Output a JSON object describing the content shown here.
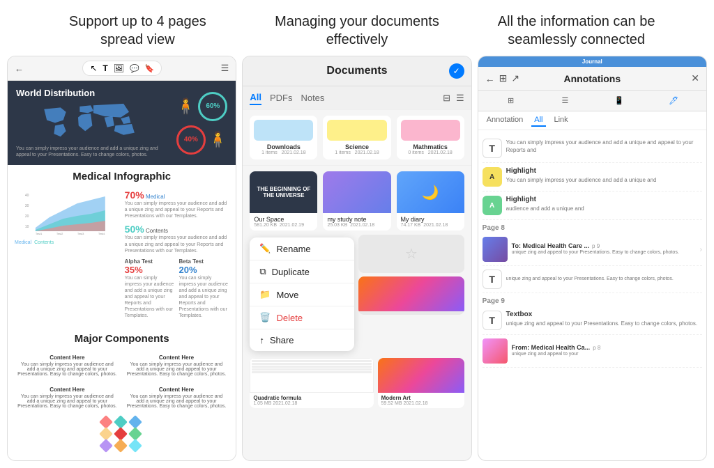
{
  "headings": {
    "col1": "Support up to 4 pages\nspread view",
    "col2": "Managing your documents\neffectively",
    "col3": "All the information can be\nseamlessly connected"
  },
  "panel1": {
    "world_dist_title": "World Distribution",
    "world_dist_text": "You can simply impress your audience and add a unique zing and appeal to your Presentations. Easy to change colors, photos.",
    "stat1": "60%",
    "stat2": "40%",
    "medical_title": "Medical Infographic",
    "medical_pct1": "70%",
    "medical_pct2": "50%",
    "medical_label1": "Medical",
    "medical_label2": "Contents",
    "alpha_label": "Alpha Test",
    "alpha_pct": "35%",
    "beta_label": "Beta Test",
    "beta_pct": "20%",
    "chart_text": "You can simply impress your audience and add a unique zing and appeal to your Reports and Presentations with our Templates.",
    "major_title": "Major Components",
    "component_header1": "Content Here",
    "component_text1": "You can simply impress your audience and add a unique zing and appeal to your Presentations. Easy to change colors, photos.",
    "component_header2": "Content Here",
    "component_text2": "You can simply impress your audience and add a unique zing and appeal to your Presentations. Easy to change colors, photos.",
    "component_header3": "Content Here",
    "component_text3": "You can simply impress your audience and add a unique zing and appeal to your Presentations. Easy to change colors, photos.",
    "component_header4": "Content Here",
    "component_text4": "You can simply impress your audience and add a unique zing and appeal to your Presentations. Easy to change colors, photos."
  },
  "panel2": {
    "title": "Documents",
    "tab_all": "All",
    "tab_pdfs": "PDFs",
    "tab_notes": "Notes",
    "folder1_name": "Downloads",
    "folder1_items": "1 items",
    "folder1_date": "2021.02.18",
    "folder2_name": "Science",
    "folder2_items": "1 items",
    "folder2_date": "2021.02.18",
    "folder3_name": "Mathmatics",
    "folder3_items": "0 items",
    "folder3_date": "2021.02.18",
    "file1_name": "Our Space",
    "file1_size": "581.20 KB",
    "file1_date": "2021.02.19",
    "file2_name": "my study note",
    "file2_size": "25.03 KB",
    "file2_date": "2021.02.18",
    "file3_name": "My diary",
    "file3_size": "74.17 KB",
    "file3_date": "2021.02.18",
    "menu_rename": "Rename",
    "menu_duplicate": "Duplicate",
    "menu_move": "Move",
    "menu_delete": "Delete",
    "menu_share": "Share",
    "bottom_file1_name": "Quadratic formula",
    "bottom_file1_size": "1.05 MB",
    "bottom_file1_date": "2021.02.18",
    "bottom_file2_name": "Modern Art",
    "bottom_file2_size": "59.52 MB",
    "bottom_file2_date": "2021.02.18"
  },
  "panel3": {
    "header_title": "Annotations",
    "journal_label": "Journal",
    "tab_annotation": "Annotation",
    "tab_all": "All",
    "tab_link": "Link",
    "ann1_title": "",
    "ann1_desc": "You can simply impress your audience and add a unique and appeal to your Reports and",
    "ann2_title": "Highlight",
    "ann2_desc": "You can simply impress your audience and add a unique and",
    "ann3_title": "Highlight",
    "ann3_desc": "audience and add a unique and",
    "page8_label": "Page 8",
    "page8_item1_title": "To: Medical Health Care ...",
    "page8_item1_pg": "p 9",
    "page8_item1_desc": "unique zing and appeal to your Presentations. Easy to change colors, photos.",
    "page8_item2_icon": "T",
    "page8_item2_desc": "unique zing and appeal to your Presentations. Easy to change colors, photos.",
    "page9_label": "Page 9",
    "page9_title": "Textbox",
    "page9_desc": "unique zing and appeal to your Presentations. Easy to change colors, photos.",
    "page9_from_title": "From: Medical Health Ca...",
    "page9_from_pg": "p 8",
    "page9_from_desc": "unique zing and appeal to your"
  },
  "icons": {
    "back": "←",
    "grid": "⊞",
    "share": "↗",
    "menu": "☰",
    "check": "✓",
    "filter": "⊟",
    "list": "☰",
    "close": "✕",
    "chevron_right": "›",
    "rename_icon": "✏",
    "duplicate_icon": "⧉",
    "move_icon": "→",
    "delete_icon": "🗑",
    "share_icon": "↑",
    "star": "☆",
    "pencil": "✏",
    "cursor": "↖",
    "text": "T",
    "speech": "💬",
    "bookmark": "🔖"
  }
}
